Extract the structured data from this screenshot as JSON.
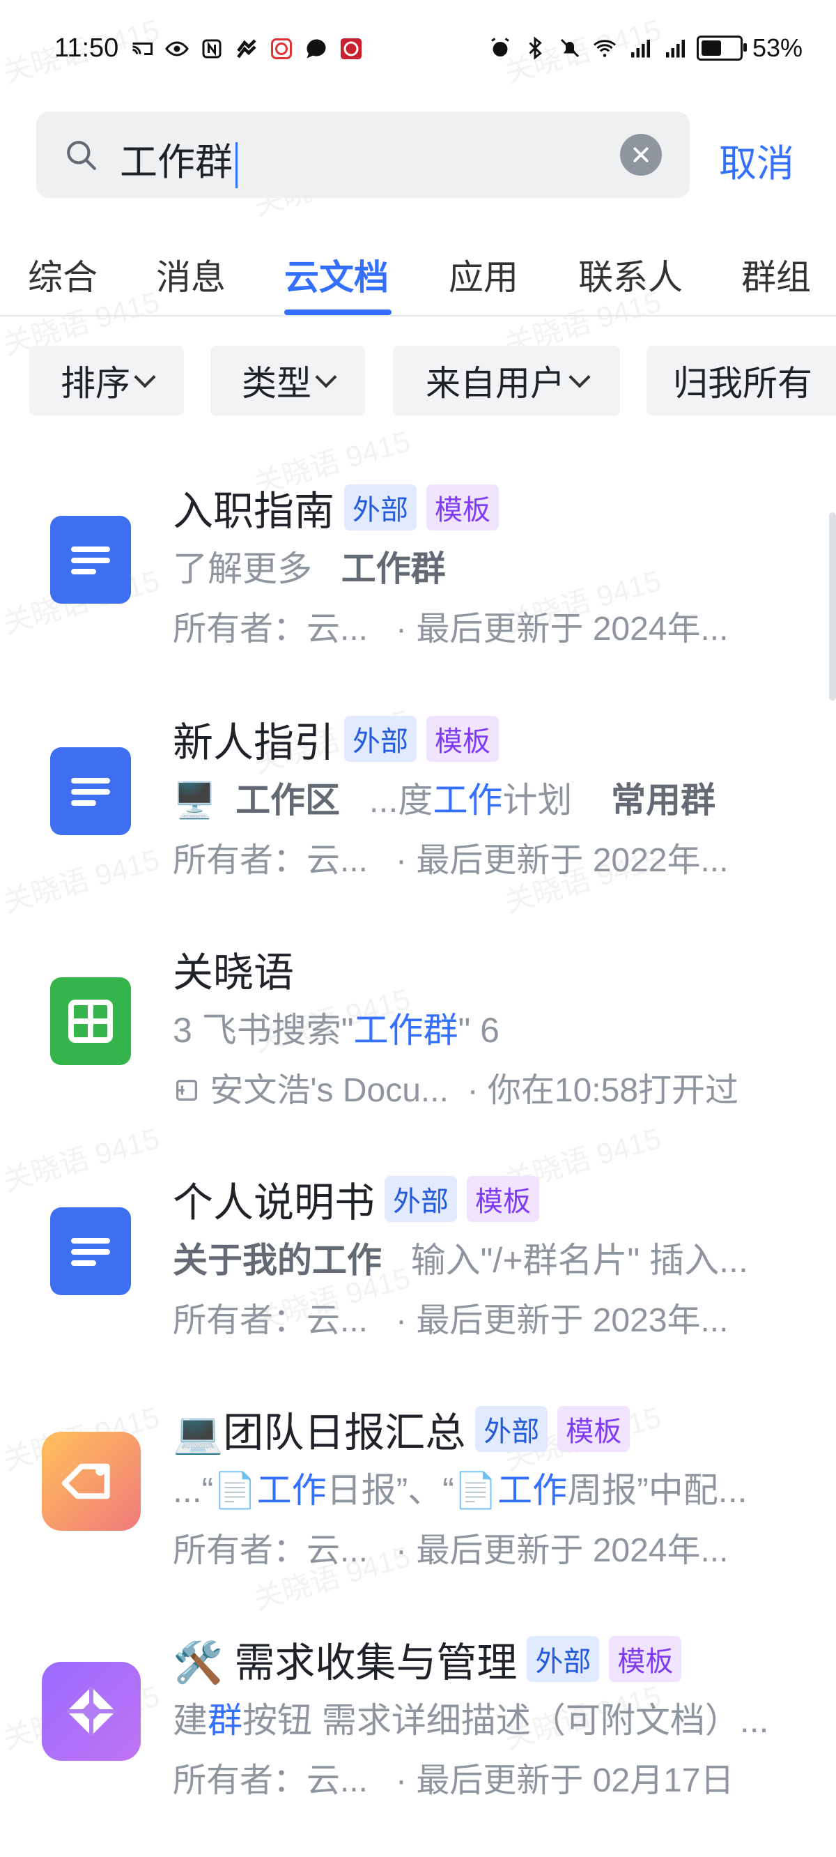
{
  "status_bar": {
    "time": "11:50",
    "battery": "53%"
  },
  "search": {
    "value": "工作群",
    "cancel_label": "取消"
  },
  "tabs": [
    {
      "label": "综合"
    },
    {
      "label": "消息"
    },
    {
      "label": "云文档"
    },
    {
      "label": "应用"
    },
    {
      "label": "联系人"
    },
    {
      "label": "群组"
    }
  ],
  "active_tab": "云文档",
  "filters": [
    {
      "label": "排序"
    },
    {
      "label": "类型"
    },
    {
      "label": "来自用户"
    },
    {
      "label": "归我所有"
    }
  ],
  "watermark": "关晓语 9415",
  "results": [
    {
      "title": "入职指南",
      "badges": [
        "外部",
        "模板"
      ],
      "line2_a": "了解更多",
      "line2_b": "工作群",
      "owner": "所有者：云...",
      "updated": "· 最后更新于 2024年..."
    },
    {
      "title": "新人指引",
      "badges": [
        "外部",
        "模板"
      ],
      "line2_a": "🖥️",
      "line2_b": "工作区",
      "line2_c": "...度",
      "line2_d": "工作",
      "line2_e": "计划",
      "line2_f": "常用群",
      "owner": "所有者：云...",
      "updated": "· 最后更新于 2022年..."
    },
    {
      "title": "关晓语",
      "line2_a": "3 飞书搜索\"",
      "line2_b": "工作群",
      "line2_c": "\" 6",
      "owner": "安文浩's Docu...",
      "updated": "· 你在10:58打开过"
    },
    {
      "title": "个人说明书",
      "badges": [
        "外部",
        "模板"
      ],
      "line2_a": "关于我的",
      "line2_b": "工作",
      "line2_c": "输入\"/+群名片\" 插入...",
      "owner": "所有者：云...",
      "updated": "· 最后更新于 2023年..."
    },
    {
      "title": "💻团队日报汇总",
      "badges": [
        "外部",
        "模板"
      ],
      "line2_a": "...“📄",
      "line2_b": "工作",
      "line2_c": "日报”、“📄",
      "line2_d": "工作",
      "line2_e": "周报”中配...",
      "owner": "所有者：云...",
      "updated": "· 最后更新于 2024年..."
    },
    {
      "title": "🛠️ 需求收集与管理",
      "badges": [
        "外部",
        "模板"
      ],
      "line2_a": "建",
      "line2_b": "群",
      "line2_c": "按钮 需求详细描述（可附文档）...",
      "owner": "所有者：云...",
      "updated": "· 最后更新于 02月17日"
    }
  ]
}
